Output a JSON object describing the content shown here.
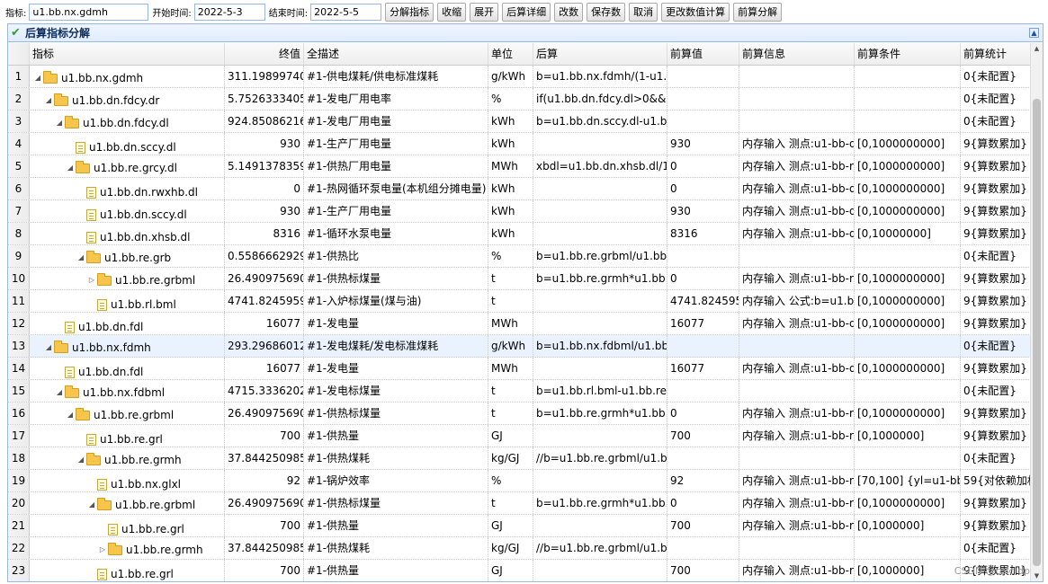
{
  "toolbar": {
    "indicator_label": "指标:",
    "indicator_value": "u1.bb.nx.gdmh",
    "start_label": "开始时间:",
    "start_value": "2022-5-3",
    "end_label": "结束时间:",
    "end_value": "2022-5-5",
    "buttons": [
      "分解指标",
      "收缩",
      "展开",
      "后算详细",
      "改数",
      "保存数",
      "取消",
      "更改数值计算",
      "前算分解"
    ]
  },
  "panel": {
    "title": "后算指标分解",
    "collapse_icon": "collapse-icon"
  },
  "table": {
    "headers": [
      "指标",
      "终值",
      "全描述",
      "单位",
      "后算",
      "前算值",
      "前算信息",
      "前算条件",
      "前算统计"
    ],
    "rows": [
      {
        "n": "1",
        "depth": 0,
        "icon": "folder",
        "arrow": "expanded",
        "name": "u1.bb.nx.gdmh",
        "value": "311.19899740",
        "desc": "#1-供电煤耗/供电标准煤耗",
        "unit": "g/kWh",
        "post": "b=u1.bb.nx.fdmh/(1-u1.bb",
        "prev": "",
        "info": "",
        "cond": "",
        "stat": "0{未配置}"
      },
      {
        "n": "2",
        "depth": 1,
        "icon": "folder",
        "arrow": "expanded",
        "name": "u1.bb.dn.fdcy.dr",
        "value": "5.75263334057",
        "desc": "#1-发电厂用电率",
        "unit": "%",
        "post": "if(u1.bb.dn.fdcy.dl>0&&u1",
        "prev": "",
        "info": "",
        "cond": "",
        "stat": "0{未配置}"
      },
      {
        "n": "3",
        "depth": 2,
        "icon": "folder",
        "arrow": "expanded",
        "name": "u1.bb.dn.fdcy.dl",
        "value": "924.85086216",
        "desc": "#1-发电厂用电量",
        "unit": "kWh",
        "post": "b=u1.bb.dn.sccy.dl-u1.bb.",
        "prev": "",
        "info": "",
        "cond": "",
        "stat": "0{未配置}"
      },
      {
        "n": "4",
        "depth": 3,
        "icon": "file",
        "arrow": "",
        "name": "u1.bb.dn.sccy.dl",
        "value": "930",
        "desc": "#1-生产厂用电量",
        "unit": "kWh",
        "post": "",
        "prev": "930",
        "info": "内存输入 测点:u1-bb-dn",
        "cond": "[0,1000000000]",
        "stat": "9{算数累加}"
      },
      {
        "n": "5",
        "depth": 3,
        "icon": "folder",
        "arrow": "expanded",
        "name": "u1.bb.re.grcy.dl",
        "value": "5.14913783590",
        "desc": "#1-供热厂用电量",
        "unit": "MWh",
        "post": "xbdl=u1.bb.dn.xhsb.dl/100",
        "prev": "0",
        "info": "内存输入 测点:u1-bb-re",
        "cond": "[0,1000000000]",
        "stat": "9{算数累加}"
      },
      {
        "n": "6",
        "depth": 4,
        "icon": "file",
        "arrow": "",
        "name": "u1.bb.dn.rwxhb.dl",
        "value": "0",
        "desc": "#1-热网循环泵电量(本机组分摊电量)",
        "unit": "kWh",
        "post": "",
        "prev": "0",
        "info": "内存输入 测点:u1-bb-dn",
        "cond": "[0,1000000000]",
        "stat": "9{算数累加}"
      },
      {
        "n": "7",
        "depth": 4,
        "icon": "file",
        "arrow": "",
        "name": "u1.bb.dn.sccy.dl",
        "value": "930",
        "desc": "#1-生产厂用电量",
        "unit": "kWh",
        "post": "",
        "prev": "930",
        "info": "内存输入 测点:u1-bb-dn",
        "cond": "[0,1000000000]",
        "stat": "9{算数累加}"
      },
      {
        "n": "8",
        "depth": 4,
        "icon": "file",
        "arrow": "",
        "name": "u1.bb.dn.xhsb.dl",
        "value": "8316",
        "desc": "#1-循环水泵电量",
        "unit": "kWh",
        "post": "",
        "prev": "8316",
        "info": "内存输入 测点:u1-bb-dn",
        "cond": "[0,10000000]",
        "stat": "9{算数累加}"
      },
      {
        "n": "9",
        "depth": 4,
        "icon": "folder",
        "arrow": "expanded",
        "name": "u1.bb.re.grb",
        "value": "0.55866629290",
        "desc": "#1-供热比",
        "unit": "%",
        "post": "b=u1.bb.re.grbml/u1.bb.rl",
        "prev": "",
        "info": "",
        "cond": "",
        "stat": "0{未配置}"
      },
      {
        "n": "10",
        "depth": 5,
        "icon": "folder",
        "arrow": "collapsed",
        "name": "u1.bb.re.grbml",
        "value": "26.490975690",
        "desc": "#1-供热标煤量",
        "unit": "t",
        "post": "b=u1.bb.re.grmh*u1.bb.re",
        "prev": "0",
        "info": "内存输入 测点:u1-bb-re",
        "cond": "[0,1000000000]",
        "stat": "9{算数累加}"
      },
      {
        "n": "11",
        "depth": 5,
        "icon": "file",
        "arrow": "",
        "name": "u1.bb.rl.bml",
        "value": "4741.8245959",
        "desc": "#1-入炉标煤量(煤与油)",
        "unit": "t",
        "post": "",
        "prev": "4741.8245959",
        "info": "内存输入 公式:b=u1.bb.",
        "cond": "[0,1000000000]",
        "stat": "9{算数累加}"
      },
      {
        "n": "12",
        "depth": 2,
        "icon": "file",
        "arrow": "",
        "name": "u1.bb.dn.fdl",
        "value": "16077",
        "desc": "#1-发电量",
        "unit": "MWh",
        "post": "",
        "prev": "16077",
        "info": "内存输入 测点:u1-bb-dn",
        "cond": "[0,1000000000]",
        "stat": "9{算数累加}"
      },
      {
        "n": "13",
        "depth": 1,
        "icon": "folder",
        "arrow": "expanded",
        "name": "u1.bb.nx.fdmh",
        "value": "293.29686012",
        "desc": "#1-发电煤耗/发电标准煤耗",
        "unit": "g/kWh",
        "post": "b=u1.bb.nx.fdbml/u1.bb.d",
        "prev": "",
        "info": "",
        "cond": "",
        "stat": "0{未配置}",
        "selected": true
      },
      {
        "n": "14",
        "depth": 2,
        "icon": "file",
        "arrow": "",
        "name": "u1.bb.dn.fdl",
        "value": "16077",
        "desc": "#1-发电量",
        "unit": "MWh",
        "post": "",
        "prev": "16077",
        "info": "内存输入 测点:u1-bb-dn",
        "cond": "[0,1000000000]",
        "stat": "9{算数累加}"
      },
      {
        "n": "15",
        "depth": 2,
        "icon": "folder",
        "arrow": "expanded",
        "name": "u1.bb.nx.fdbml",
        "value": "4715.3336202",
        "desc": "#1-发电标煤量",
        "unit": "t",
        "post": "b=u1.bb.rl.bml-u1.bb.re.g",
        "prev": "",
        "info": "",
        "cond": "",
        "stat": "0{未配置}"
      },
      {
        "n": "16",
        "depth": 3,
        "icon": "folder",
        "arrow": "expanded",
        "name": "u1.bb.re.grbml",
        "value": "26.490975690",
        "desc": "#1-供热标煤量",
        "unit": "t",
        "post": "b=u1.bb.re.grmh*u1.bb.re",
        "prev": "0",
        "info": "内存输入 测点:u1-bb-re",
        "cond": "[0,1000000000]",
        "stat": "9{算数累加}"
      },
      {
        "n": "17",
        "depth": 4,
        "icon": "file",
        "arrow": "",
        "name": "u1.bb.re.grl",
        "value": "700",
        "desc": "#1-供热量",
        "unit": "GJ",
        "post": "",
        "prev": "700",
        "info": "内存输入 测点:u1-bb-re",
        "cond": "[0,1000000]",
        "stat": "9{算数累加}"
      },
      {
        "n": "18",
        "depth": 4,
        "icon": "folder",
        "arrow": "expanded",
        "name": "u1.bb.re.grmh",
        "value": "37.844250985",
        "desc": "#1-供热煤耗",
        "unit": "kg/GJ",
        "post": "//b=u1.bb.re.grbml/u1.bb",
        "prev": "",
        "info": "",
        "cond": "",
        "stat": "0{未配置}"
      },
      {
        "n": "19",
        "depth": 5,
        "icon": "file",
        "arrow": "",
        "name": "u1.bb.nx.glxl",
        "value": "92",
        "desc": "#1-锅炉效率",
        "unit": "%",
        "post": "",
        "prev": "92",
        "info": "内存输入 测点:u1-bb-nx",
        "cond": "[70,100] {yl=u1-bb-",
        "stat": "59{对依赖加权"
      },
      {
        "n": "20",
        "depth": 5,
        "icon": "folder",
        "arrow": "expanded",
        "name": "u1.bb.re.grbml",
        "value": "26.490975690",
        "desc": "#1-供热标煤量",
        "unit": "t",
        "post": "b=u1.bb.re.grmh*u1.bb.re",
        "prev": "0",
        "info": "内存输入 测点:u1-bb-re",
        "cond": "[0,1000000000]",
        "stat": "9{算数累加}"
      },
      {
        "n": "21",
        "depth": 6,
        "icon": "file",
        "arrow": "",
        "name": "u1.bb.re.grl",
        "value": "700",
        "desc": "#1-供热量",
        "unit": "GJ",
        "post": "",
        "prev": "700",
        "info": "内存输入 测点:u1-bb-re",
        "cond": "[0,1000000]",
        "stat": "9{算数累加}"
      },
      {
        "n": "22",
        "depth": 6,
        "icon": "folder",
        "arrow": "collapsed",
        "name": "u1.bb.re.grmh",
        "value": "37.844250985",
        "desc": "#1-供热煤耗",
        "unit": "kg/GJ",
        "post": "//b=u1.bb.re.grbml/u1.bb",
        "prev": "",
        "info": "",
        "cond": "",
        "stat": "0{未配置}"
      },
      {
        "n": "23",
        "depth": 5,
        "icon": "file",
        "arrow": "",
        "name": "u1.bb.re.grl",
        "value": "700",
        "desc": "#1-供热量",
        "unit": "GJ",
        "post": "",
        "prev": "700",
        "info": "内存输入 测点:u1-bb-re",
        "cond": "[0,1000000]",
        "stat": "9{算数累加}"
      }
    ]
  },
  "watermark": "CSDN @cslc dp"
}
